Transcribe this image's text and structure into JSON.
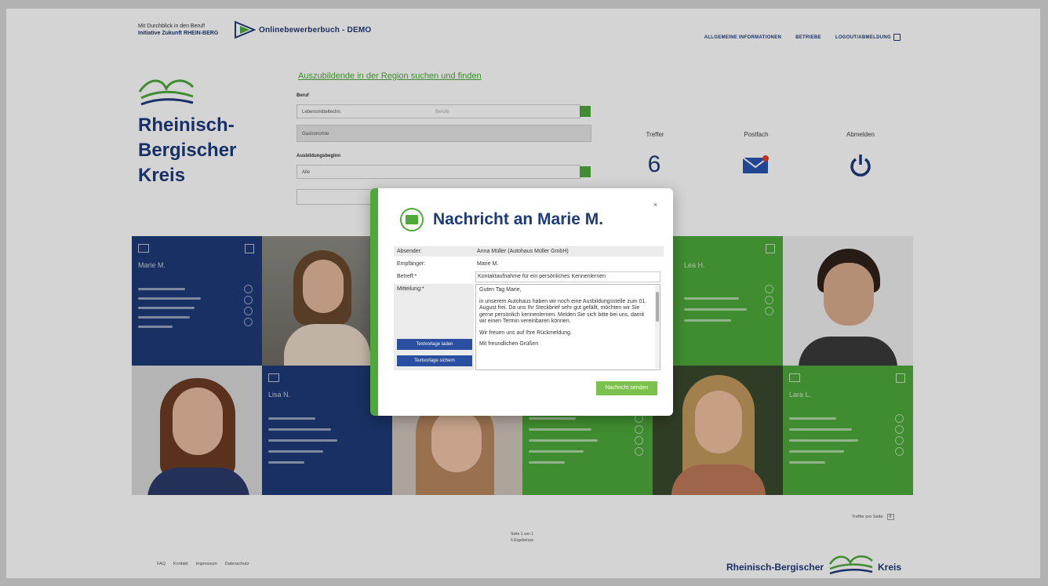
{
  "header": {
    "logo_line1": "Mit Durchblick in den Beruf!",
    "logo_line2": "Initiative Zukunft RHEIN-BERG",
    "site_title": "Onlinebewerberbuch - DEMO",
    "nav": [
      "ALLGEMEINE INFORMATIONEN",
      "BETRIEBE",
      "LOGOUT/ABMELDUNG"
    ]
  },
  "brand": {
    "name": "Rheinisch-Bergischer Kreis"
  },
  "search": {
    "title": "Auszubildende in der Region suchen und finden",
    "beruf_label": "Beruf",
    "beruf_field": "Lebensmitteltechn.",
    "beruf_hint": "Berufe",
    "second_field": "Gastronomie",
    "beginn_label": "Ausbildungsbeginn",
    "beginn_value": "Alle"
  },
  "stats": {
    "treffer_label": "Treffer",
    "treffer_count": "6",
    "postfach_label": "Postfach",
    "postfach_badge": "1",
    "abmelden_label": "Abmelden"
  },
  "tiles": [
    {
      "name": "Marie M."
    },
    {
      "name": "Lea H."
    },
    {
      "name": "Lisa N."
    },
    {
      "name": "Lara L."
    }
  ],
  "footer": {
    "links": [
      "FAQ",
      "Kontakt",
      "Impressum",
      "Datenschutz"
    ],
    "pager_line1": "Seite 1 von 1",
    "pager_line2": "6 Ergebnisse",
    "perpage_label": "Treffer pro Seite:",
    "perpage_value": "8",
    "brand_left": "Rheinisch-Bergischer",
    "brand_right": "Kreis"
  },
  "modal": {
    "title": "Nachricht an Marie M.",
    "close": "×",
    "absender_label": "Absender:",
    "absender_value": "Anna Müller (Autohaus Müller GmbH)",
    "empfaenger_label": "Empfänger:",
    "empfaenger_value": "Marie M.",
    "betreff_label": "Betreff:*",
    "betreff_value": "Kontaktaufnahme für ein persönliches Kennenlernen",
    "mitteilung_label": "Mitteilung:*",
    "message_p1": "Guten Tag Marie,",
    "message_p2": "in unserem Autohaus haben wir noch eine Ausbildungsstelle zum 01. August frei. Da uns Ihr Steckbrief sehr gut gefällt, möchten wir Sie gerne persönlich kennenlernen. Melden Sie sich bitte bei uns, damit wir einen Termin vereinbaren können.",
    "message_p3": "Wir freuen uns auf Ihre Rückmeldung.",
    "message_p4": "Mit freundlichen Grüßen",
    "tpl_load": "Textvorlage laden",
    "tpl_save": "Textvorlage sichern",
    "send": "Nachricht senden"
  },
  "colors": {
    "navy": "#1e3a78",
    "green": "#4ea93a"
  }
}
